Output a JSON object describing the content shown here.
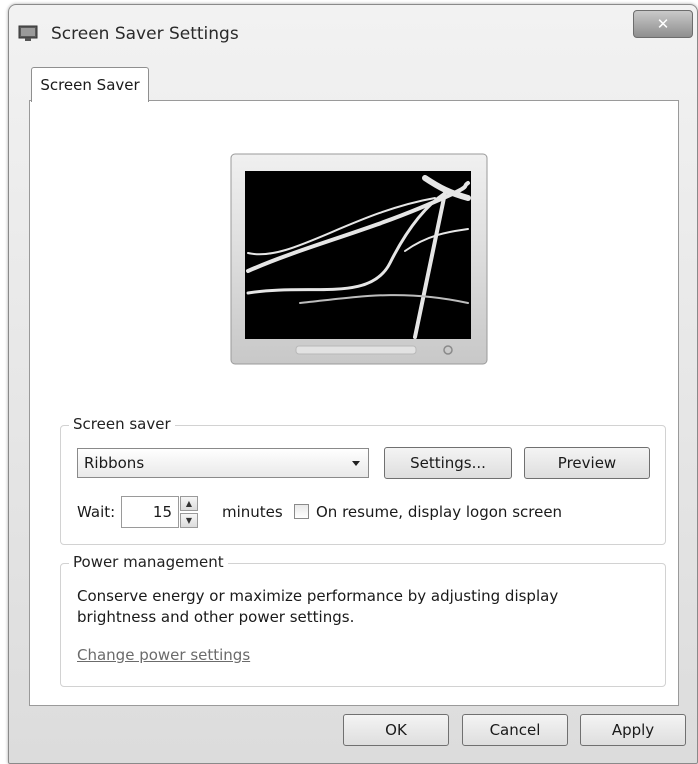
{
  "window": {
    "title": "Screen Saver Settings",
    "close_symbol": "✕"
  },
  "tabs": [
    {
      "label": "Screen Saver"
    }
  ],
  "screen_saver": {
    "group_label": "Screen saver",
    "selected": "Ribbons",
    "settings_button": "Settings...",
    "preview_button": "Preview",
    "wait_label": "Wait:",
    "wait_value": "15",
    "minutes_label": "minutes",
    "resume_checkbox_label": "On resume, display logon screen",
    "resume_checked": false
  },
  "power_management": {
    "group_label": "Power management",
    "description": "Conserve energy or maximize performance by adjusting display brightness and other power settings.",
    "link": "Change power settings"
  },
  "buttons": {
    "ok": "OK",
    "cancel": "Cancel",
    "apply": "Apply"
  },
  "icons": {
    "window": "monitor-icon",
    "close": "close-icon",
    "spin_up": "chevron-up-icon",
    "spin_down": "chevron-down-icon",
    "dropdown": "dropdown-arrow-icon"
  }
}
